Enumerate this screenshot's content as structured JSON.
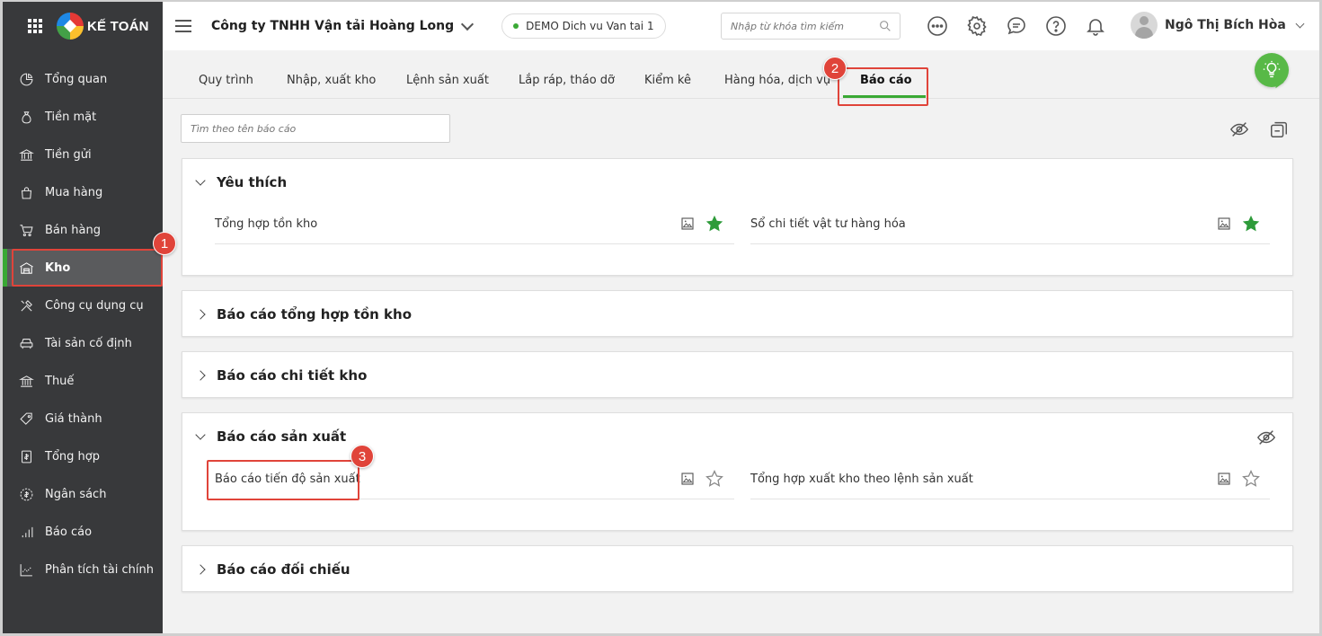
{
  "brand": {
    "name": "KẾ TOÁN"
  },
  "sidebar": {
    "items": [
      {
        "label": "Tổng quan",
        "icon": "dashboard-icon"
      },
      {
        "label": "Tiền mặt",
        "icon": "money-bag-icon"
      },
      {
        "label": "Tiền gửi",
        "icon": "bank-icon"
      },
      {
        "label": "Mua hàng",
        "icon": "shopping-bag-icon"
      },
      {
        "label": "Bán hàng",
        "icon": "cart-icon"
      },
      {
        "label": "Kho",
        "icon": "warehouse-icon",
        "active": true
      },
      {
        "label": "Công cụ dụng cụ",
        "icon": "tools-icon"
      },
      {
        "label": "Tài sản cố định",
        "icon": "car-icon"
      },
      {
        "label": "Thuế",
        "icon": "tax-building-icon"
      },
      {
        "label": "Giá thành",
        "icon": "price-tag-icon"
      },
      {
        "label": "Tổng hợp",
        "icon": "ledger-icon"
      },
      {
        "label": "Ngân sách",
        "icon": "budget-coin-icon"
      },
      {
        "label": "Báo cáo",
        "icon": "bar-chart-icon"
      },
      {
        "label": "Phân tích tài chính",
        "icon": "trend-chart-icon"
      }
    ]
  },
  "header": {
    "company": "Công ty TNHH Vận tải Hoàng Long",
    "demo_label": "DEMO Dich vu Van tai 1",
    "search_placeholder": "Nhập từ khóa tìm kiếm",
    "user_name": "Ngô Thị Bích Hòa"
  },
  "tabs": [
    {
      "label": "Quy trình"
    },
    {
      "label": "Nhập, xuất kho"
    },
    {
      "label": "Lệnh sản xuất"
    },
    {
      "label": "Lắp ráp, tháo dỡ"
    },
    {
      "label": "Kiểm kê"
    },
    {
      "label": "Hàng hóa, dịch vụ"
    },
    {
      "label": "Báo cáo",
      "active": true
    }
  ],
  "report_search": {
    "placeholder": "Tìm theo tên báo cáo"
  },
  "groups": {
    "favorites": {
      "title": "Yêu thích",
      "items": [
        {
          "label": "Tổng hợp tồn kho",
          "starred": true
        },
        {
          "label": "Sổ chi tiết vật tư hàng hóa",
          "starred": true
        }
      ]
    },
    "inventory_summary": {
      "title": "Báo cáo tổng hợp tồn kho"
    },
    "inventory_detail": {
      "title": "Báo cáo chi tiết kho"
    },
    "production": {
      "title": "Báo cáo sản xuất",
      "items": [
        {
          "label": "Báo cáo tiến độ sản xuất",
          "starred": false
        },
        {
          "label": "Tổng hợp xuất kho theo lệnh sản xuất",
          "starred": false
        }
      ]
    },
    "reconciliation": {
      "title": "Báo cáo đối chiếu"
    }
  },
  "callouts": {
    "one": "1",
    "two": "2",
    "three": "3"
  },
  "colors": {
    "accent": "#3aa935",
    "sidebar_bg": "#38393b",
    "callout": "#e0443a",
    "star": "#2e9b3a"
  }
}
